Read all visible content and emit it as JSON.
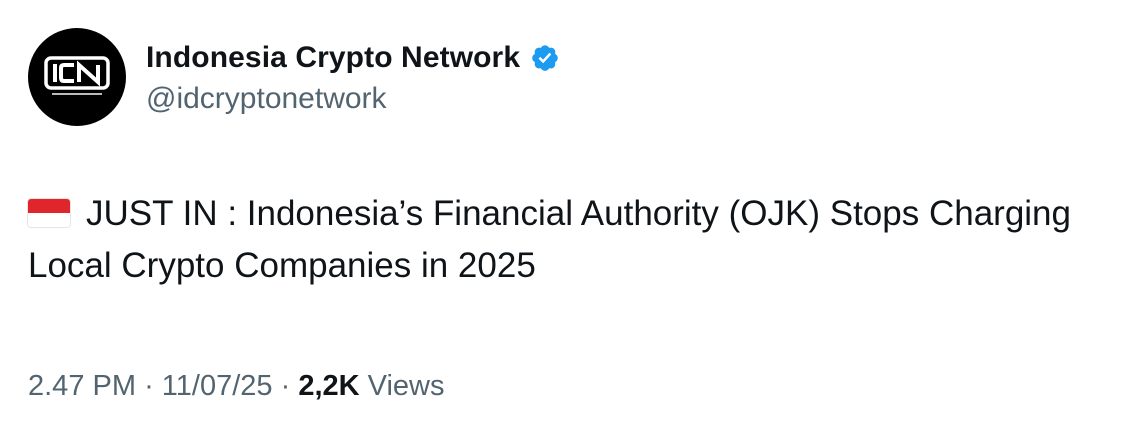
{
  "author": {
    "display_name": "Indonesia Crypto Network",
    "handle": "@idcryptonetwork",
    "avatar_text": "ICN",
    "verified_icon": "verified-badge-icon"
  },
  "post": {
    "flag_icon": "indonesia-flag-icon",
    "text": "JUST IN : Indonesia’s Financial Authority (OJK) Stops Charging Local Crypto Companies in 2025"
  },
  "meta": {
    "time": "2.47 PM",
    "separator": "·",
    "date": "11/07/25",
    "views_count": "2,2K",
    "views_label": "Views"
  },
  "colors": {
    "text_primary": "#0f1419",
    "text_secondary": "#536471",
    "verified_blue": "#1d9bf0",
    "flag_red": "#e0262b",
    "avatar_bg": "#000000"
  }
}
